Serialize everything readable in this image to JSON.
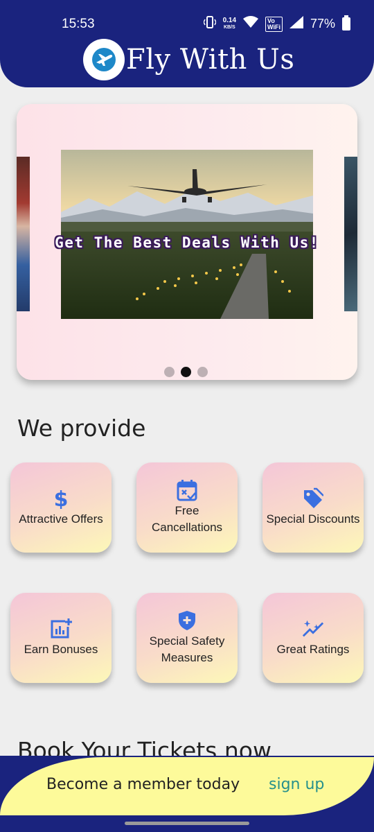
{
  "status_bar": {
    "time": "15:53",
    "net_speed_value": "0.14",
    "net_speed_unit": "KB/S",
    "volte_line1": "Vo",
    "volte_line2": "WiFi",
    "battery": "77%"
  },
  "header": {
    "title": "Fly With Us",
    "logo_icon": "airplane-logo-icon",
    "background": "#1a237e"
  },
  "carousel": {
    "banner_text": "Get The Best Deals With Us!",
    "page_count": 3,
    "active_index": 1
  },
  "sections": {
    "provide_title": "We provide",
    "book_title": "Book Your Tickets now"
  },
  "features": [
    {
      "label": "Attractive Offers",
      "icon": "dollar-icon"
    },
    {
      "label": "Free Cancellations",
      "icon": "calendar-cancel-icon"
    },
    {
      "label": "Special Discounts",
      "icon": "tag-icon"
    },
    {
      "label": "Earn Bonuses",
      "icon": "chart-add-icon"
    },
    {
      "label": "Special Safety Measures",
      "icon": "shield-plus-icon"
    },
    {
      "label": "Great Ratings",
      "icon": "sparkle-trend-icon"
    }
  ],
  "member_banner": {
    "text": "Become a member today",
    "link": "sign up",
    "accent": "#26908c",
    "background": "#fdfa9a"
  }
}
